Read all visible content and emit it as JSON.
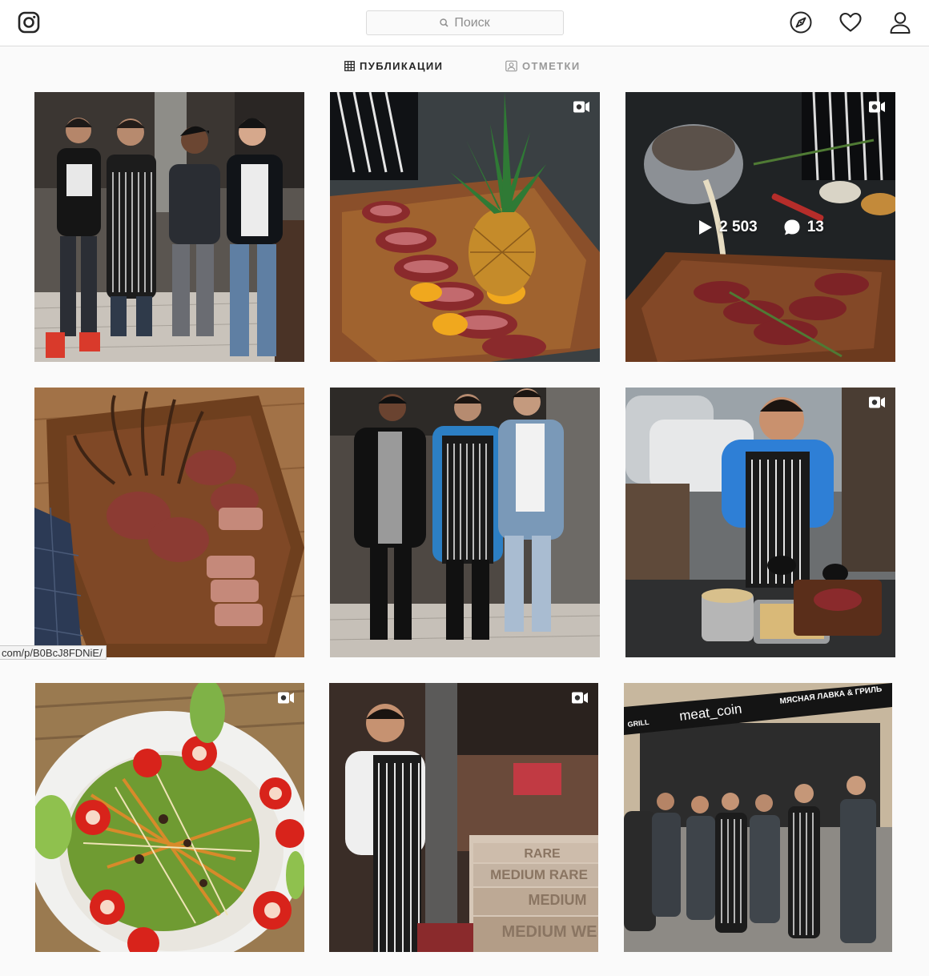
{
  "header": {
    "logo_icon": "instagram-camera-icon",
    "search": {
      "placeholder": "Поиск",
      "icon": "magnifier-icon"
    },
    "nav_icons": [
      "compass-icon",
      "heart-icon",
      "profile-icon"
    ]
  },
  "tabs": [
    {
      "label": "ПУБЛИКАЦИИ",
      "icon": "grid-icon",
      "active": true
    },
    {
      "label": "ОТМЕТКИ",
      "icon": "tagged-icon",
      "active": false
    }
  ],
  "posts": [
    {
      "subject": "four men in a restaurant, one in striped apron",
      "video": false
    },
    {
      "subject": "sliced steak with pineapple on wooden board",
      "video": true
    },
    {
      "subject": "sauce poured over sliced steak with rosemary",
      "video": true,
      "hover": {
        "views": "2 503",
        "comments": "13"
      }
    },
    {
      "subject": "rack of lamb chops on wooden board",
      "video": false
    },
    {
      "subject": "three men in restaurant, middle one in striped apron",
      "video": false
    },
    {
      "subject": "chef in blue shirt cutting steak on terrace",
      "video": true
    },
    {
      "subject": "salad with tomatoes, cucumber and carrots",
      "video": true
    },
    {
      "subject": "chef in striped apron by doneness steps RARE MEDIUM",
      "video": true,
      "steps": [
        "RARE",
        "MEDIUM RARE",
        "MEDIUM",
        "MEDIUM WE"
      ]
    },
    {
      "subject": "team of chefs in aprons under meat_coin awning",
      "video": false,
      "awning": {
        "brand": "meat_coin",
        "tagline": "МЯСНАЯ ЛАВКА & ГРИЛЬ",
        "left": "GRILL"
      }
    }
  ],
  "status_bar": {
    "url": "com/p/B0BcJ8FDNiE/"
  },
  "colors": {
    "border": "#dbdbdb",
    "bg": "#fafafa",
    "text": "#262626",
    "muted": "#8e8e8e"
  }
}
